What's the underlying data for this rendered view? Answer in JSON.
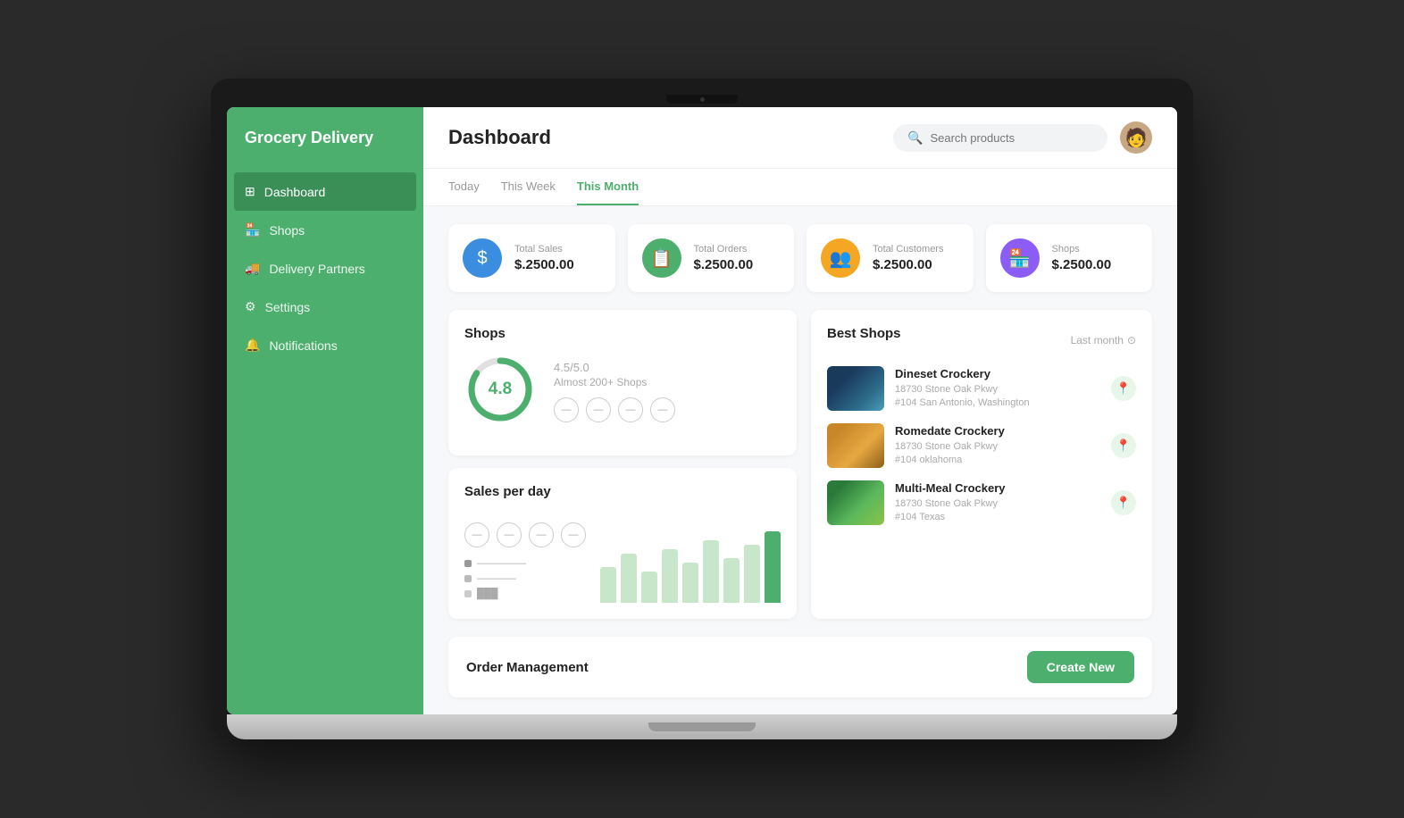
{
  "app": {
    "name": "Grocery Delivery"
  },
  "sidebar": {
    "items": [
      {
        "id": "dashboard",
        "label": "Dashboard",
        "active": true
      },
      {
        "id": "shops",
        "label": "Shops",
        "active": false
      },
      {
        "id": "delivery-partners",
        "label": "Delivery Partners",
        "active": false
      },
      {
        "id": "settings",
        "label": "Settings",
        "active": false
      },
      {
        "id": "notifications",
        "label": "Notifications",
        "active": false
      }
    ]
  },
  "header": {
    "title": "Dashboard",
    "search_placeholder": "Search products"
  },
  "tabs": [
    {
      "id": "today",
      "label": "Today",
      "active": false
    },
    {
      "id": "this-week",
      "label": "This Week",
      "active": false
    },
    {
      "id": "this-month",
      "label": "This Month",
      "active": true
    }
  ],
  "stat_cards": [
    {
      "id": "total-sales",
      "label": "Total Sales",
      "value": "$.2500.00",
      "icon": "$",
      "color": "blue"
    },
    {
      "id": "total-orders",
      "label": "Total Orders",
      "value": "$.2500.00",
      "icon": "📋",
      "color": "green"
    },
    {
      "id": "total-customers",
      "label": "Total Customers",
      "value": "$.2500.00",
      "icon": "👥",
      "color": "orange"
    },
    {
      "id": "shops",
      "label": "Shops",
      "value": "$.2500.00",
      "icon": "🏪",
      "color": "purple"
    }
  ],
  "shops_panel": {
    "title": "Shops",
    "rating_value": "4.8",
    "rating_score": "4.5",
    "rating_max": "/5.0",
    "rating_sub": "Almost 200+ Shops"
  },
  "sales_panel": {
    "title": "Sales per day",
    "bars": [
      40,
      55,
      35,
      60,
      45,
      70,
      50,
      65,
      80
    ],
    "bar_colors": [
      "light",
      "light",
      "light",
      "light",
      "light",
      "light",
      "light",
      "light",
      "dark"
    ]
  },
  "best_shops": {
    "title": "Best Shops",
    "filter_label": "Last month",
    "items": [
      {
        "name": "Dineset Crockery",
        "address_line1": "18730 Stone Oak Pkwy",
        "address_line2": "#104 San Antonio, Washington",
        "thumb_class": "shop-thumb-1"
      },
      {
        "name": "Romedate Crockery",
        "address_line1": "18730 Stone Oak Pkwy",
        "address_line2": "#104 oklahoma",
        "thumb_class": "shop-thumb-2"
      },
      {
        "name": "Multi-Meal Crockery",
        "address_line1": "18730 Stone Oak Pkwy",
        "address_line2": "#104 Texas",
        "thumb_class": "shop-thumb-3"
      }
    ]
  },
  "order_management": {
    "title": "Order Management",
    "create_new_label": "Create New"
  }
}
